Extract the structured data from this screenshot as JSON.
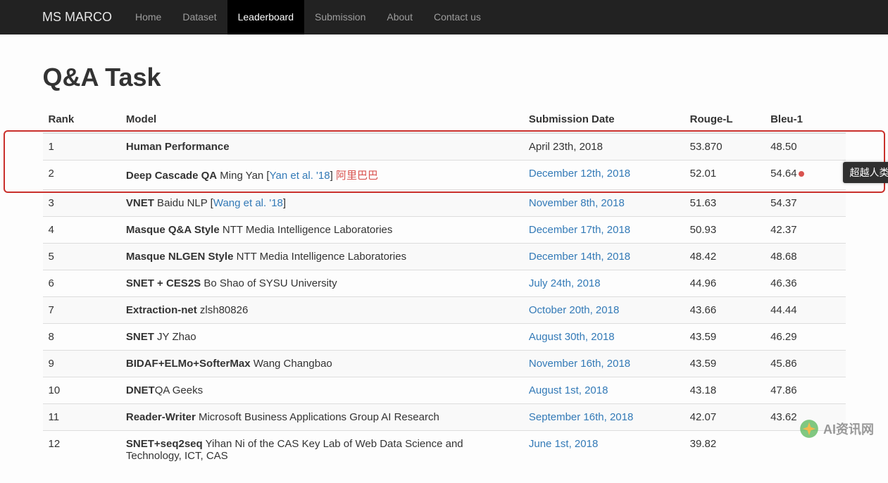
{
  "nav": {
    "brand": "MS MARCO",
    "items": [
      {
        "label": "Home",
        "active": false
      },
      {
        "label": "Dataset",
        "active": false
      },
      {
        "label": "Leaderboard",
        "active": true
      },
      {
        "label": "Submission",
        "active": false
      },
      {
        "label": "About",
        "active": false
      },
      {
        "label": "Contact us",
        "active": false
      }
    ]
  },
  "page_title": "Q&A Task",
  "table_headers": {
    "rank": "Rank",
    "model": "Model",
    "date": "Submission Date",
    "rouge": "Rouge-L",
    "bleu": "Bleu-1"
  },
  "rows": [
    {
      "rank": "1",
      "model_bold": "Human Performance",
      "model_rest": "",
      "citation": "",
      "citation_red": false,
      "extra_red": "",
      "date": "April 23th, 2018",
      "date_link": false,
      "rouge": "53.870",
      "bleu": "48.50",
      "bleu_dot": false
    },
    {
      "rank": "2",
      "model_bold": "Deep Cascade QA",
      "model_rest": " Ming Yan [",
      "citation": "Yan et al. '18",
      "citation_red": false,
      "close_bracket": "]   ",
      "extra_red": "阿里巴巴",
      "date": "December 12th, 2018",
      "date_link": true,
      "rouge": "52.01",
      "bleu": "54.64",
      "bleu_dot": true
    },
    {
      "rank": "3",
      "model_bold": "VNET",
      "model_rest": " Baidu NLP [",
      "citation": "Wang et al. '18",
      "citation_red": false,
      "close_bracket": "]",
      "extra_red": "",
      "date": "November 8th, 2018",
      "date_link": true,
      "rouge": "51.63",
      "bleu": "54.37",
      "bleu_dot": false
    },
    {
      "rank": "4",
      "model_bold": "Masque Q&A Style",
      "model_rest": " NTT Media Intelligence Laboratories",
      "citation": "",
      "close_bracket": "",
      "extra_red": "",
      "date": "December 17th, 2018",
      "date_link": true,
      "rouge": "50.93",
      "bleu": "42.37",
      "bleu_dot": false
    },
    {
      "rank": "5",
      "model_bold": "Masque NLGEN Style",
      "model_rest": " NTT Media Intelligence Laboratories",
      "citation": "",
      "close_bracket": "",
      "extra_red": "",
      "date": "December 14th, 2018",
      "date_link": true,
      "rouge": "48.42",
      "bleu": "48.68",
      "bleu_dot": false
    },
    {
      "rank": "6",
      "model_bold": "SNET + CES2S",
      "model_rest": " Bo Shao of SYSU University",
      "citation": "",
      "close_bracket": "",
      "extra_red": "",
      "date": "July 24th, 2018",
      "date_link": true,
      "rouge": "44.96",
      "bleu": "46.36",
      "bleu_dot": false
    },
    {
      "rank": "7",
      "model_bold": "Extraction-net",
      "model_rest": " zlsh80826",
      "citation": "",
      "close_bracket": "",
      "extra_red": "",
      "date": "October 20th, 2018",
      "date_link": true,
      "rouge": "43.66",
      "bleu": "44.44",
      "bleu_dot": false
    },
    {
      "rank": "8",
      "model_bold": "SNET",
      "model_rest": " JY Zhao",
      "citation": "",
      "close_bracket": "",
      "extra_red": "",
      "date": "August 30th, 2018",
      "date_link": true,
      "rouge": "43.59",
      "bleu": "46.29",
      "bleu_dot": false
    },
    {
      "rank": "9",
      "model_bold": "BIDAF+ELMo+SofterMax",
      "model_rest": " Wang Changbao",
      "citation": "",
      "close_bracket": "",
      "extra_red": "",
      "date": "November 16th, 2018",
      "date_link": true,
      "rouge": "43.59",
      "bleu": "45.86",
      "bleu_dot": false
    },
    {
      "rank": "10",
      "model_bold": "DNET",
      "model_rest": "QA Geeks",
      "citation": "",
      "close_bracket": "",
      "extra_red": "",
      "date": "August 1st, 2018",
      "date_link": true,
      "rouge": "43.18",
      "bleu": "47.86",
      "bleu_dot": false
    },
    {
      "rank": "11",
      "model_bold": "Reader-Writer",
      "model_rest": " Microsoft Business Applications Group AI Research",
      "citation": "",
      "close_bracket": "",
      "extra_red": "",
      "date": "September 16th, 2018",
      "date_link": true,
      "rouge": "42.07",
      "bleu": "43.62",
      "bleu_dot": false
    },
    {
      "rank": "12",
      "model_bold": "SNET+seq2seq",
      "model_rest": " Yihan Ni of the CAS Key Lab of Web Data Science and Technology, ICT, CAS",
      "citation": "",
      "close_bracket": "",
      "extra_red": "",
      "date": "June 1st, 2018",
      "date_link": true,
      "rouge": "39.82",
      "bleu": "",
      "bleu_dot": false
    }
  ],
  "tooltip_text": "超越人类",
  "watermark_text": "AI资讯网"
}
